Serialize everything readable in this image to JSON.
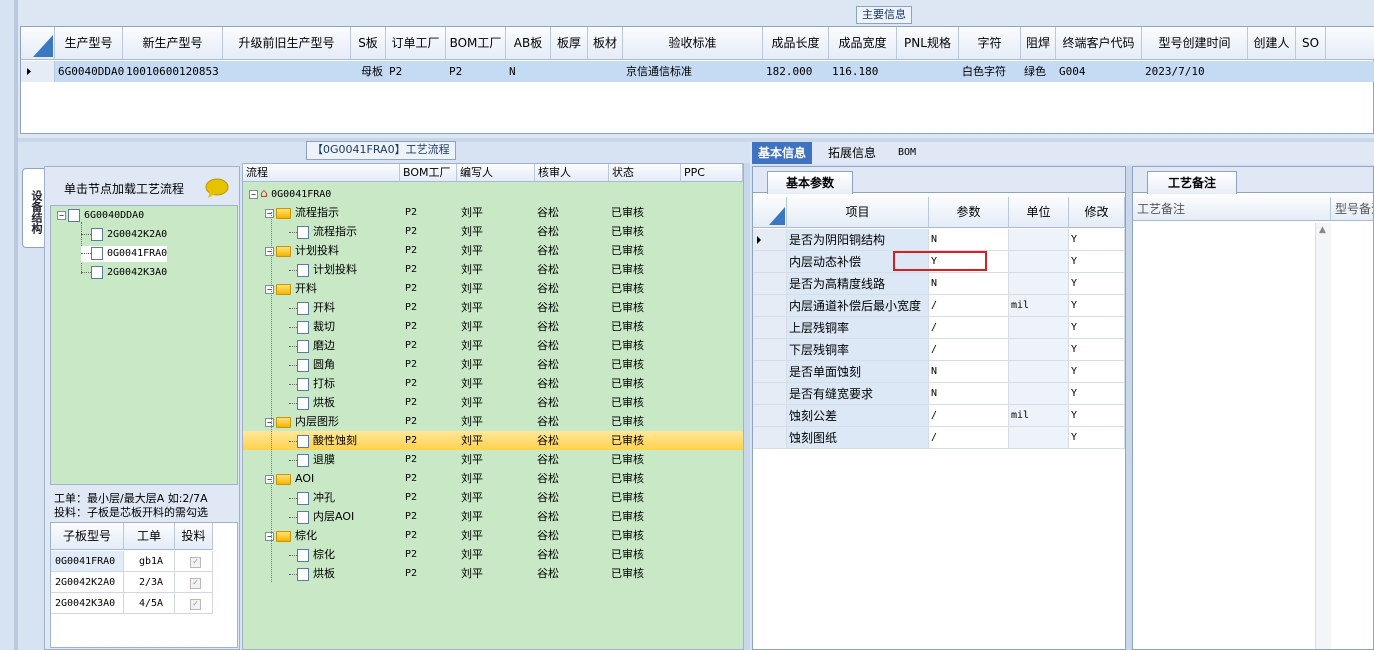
{
  "main_info": {
    "group_title": "主要信息",
    "columns": [
      "生产型号",
      "新生产型号",
      "升级前旧生产型号",
      "S板",
      "订单工厂",
      "BOM工厂",
      "AB板",
      "板厚",
      "板材",
      "验收标准",
      "成品长度",
      "成品宽度",
      "PNL规格",
      "字符",
      "阻焊",
      "终端客户代码",
      "型号创建时间",
      "创建人",
      "SO"
    ],
    "row": {
      "prod_model": "6G0040DDA0",
      "new_prod_model": "10010600120853",
      "old_model": "",
      "s_board": "母板",
      "order_factory": "P2",
      "bom_factory": "P2",
      "ab_board": "N",
      "thickness": "",
      "material": "",
      "acceptance": "京信通信标准",
      "length": "182.000",
      "width": "116.180",
      "pnl": "",
      "char": "白色字符",
      "solder": "绿色",
      "customer": "G004",
      "created": "2023/7/10",
      "creator": "",
      "so": ""
    }
  },
  "left": {
    "vertical_tab": "设备结构",
    "hint": "单击节点加载工艺流程",
    "tree": {
      "root": "6G0040DDA0",
      "children": [
        "2G0042K2A0",
        "0G0041FRA0",
        "2G0042K3A0"
      ]
    },
    "note_line1": "工单：最小层/最大层A 如:2/7A",
    "note_line2": "投料：子板是芯板开料的需勾选",
    "sub_columns": [
      "子板型号",
      "工单",
      "投料"
    ],
    "sub_rows": [
      {
        "model": "0G0041FRA0",
        "order": "gb1A",
        "feed": "✓"
      },
      {
        "model": "2G0042K2A0",
        "order": "2/3A",
        "feed": "✓"
      },
      {
        "model": "2G0042K3A0",
        "order": "4/5A",
        "feed": "✓"
      }
    ]
  },
  "flow": {
    "group_title": "【0G0041FRA0】工艺流程",
    "columns": [
      "流程",
      "BOM工厂",
      "编写人",
      "核审人",
      "状态",
      "PPC"
    ],
    "root": "0G0041FRA0",
    "rows": [
      {
        "name": "流程指示",
        "level": 1,
        "folder": true,
        "bom": "P2",
        "writer": "刘平",
        "reviewer": "谷松",
        "status": "已审核"
      },
      {
        "name": "流程指示",
        "level": 2,
        "folder": false,
        "bom": "P2",
        "writer": "刘平",
        "reviewer": "谷松",
        "status": "已审核"
      },
      {
        "name": "计划投料",
        "level": 1,
        "folder": true,
        "bom": "P2",
        "writer": "刘平",
        "reviewer": "谷松",
        "status": "已审核"
      },
      {
        "name": "计划投料",
        "level": 2,
        "folder": false,
        "bom": "P2",
        "writer": "刘平",
        "reviewer": "谷松",
        "status": "已审核"
      },
      {
        "name": "开料",
        "level": 1,
        "folder": true,
        "bom": "P2",
        "writer": "刘平",
        "reviewer": "谷松",
        "status": "已审核"
      },
      {
        "name": "开料",
        "level": 2,
        "folder": false,
        "bom": "P2",
        "writer": "刘平",
        "reviewer": "谷松",
        "status": "已审核"
      },
      {
        "name": "裁切",
        "level": 2,
        "folder": false,
        "bom": "P2",
        "writer": "刘平",
        "reviewer": "谷松",
        "status": "已审核"
      },
      {
        "name": "磨边",
        "level": 2,
        "folder": false,
        "bom": "P2",
        "writer": "刘平",
        "reviewer": "谷松",
        "status": "已审核"
      },
      {
        "name": "圆角",
        "level": 2,
        "folder": false,
        "bom": "P2",
        "writer": "刘平",
        "reviewer": "谷松",
        "status": "已审核"
      },
      {
        "name": "打标",
        "level": 2,
        "folder": false,
        "bom": "P2",
        "writer": "刘平",
        "reviewer": "谷松",
        "status": "已审核"
      },
      {
        "name": "烘板",
        "level": 2,
        "folder": false,
        "bom": "P2",
        "writer": "刘平",
        "reviewer": "谷松",
        "status": "已审核"
      },
      {
        "name": "内层图形",
        "level": 1,
        "folder": true,
        "bom": "P2",
        "writer": "刘平",
        "reviewer": "谷松",
        "status": "已审核"
      },
      {
        "name": "酸性蚀刻",
        "level": 2,
        "folder": false,
        "bom": "P2",
        "writer": "刘平",
        "reviewer": "谷松",
        "status": "已审核",
        "selected": true
      },
      {
        "name": "退膜",
        "level": 2,
        "folder": false,
        "bom": "P2",
        "writer": "刘平",
        "reviewer": "谷松",
        "status": "已审核"
      },
      {
        "name": "AOI",
        "level": 1,
        "folder": true,
        "bom": "P2",
        "writer": "刘平",
        "reviewer": "谷松",
        "status": "已审核"
      },
      {
        "name": "冲孔",
        "level": 2,
        "folder": false,
        "bom": "P2",
        "writer": "刘平",
        "reviewer": "谷松",
        "status": "已审核"
      },
      {
        "name": "内层AOI",
        "level": 2,
        "folder": false,
        "bom": "P2",
        "writer": "刘平",
        "reviewer": "谷松",
        "status": "已审核"
      },
      {
        "name": "棕化",
        "level": 1,
        "folder": true,
        "bom": "P2",
        "writer": "刘平",
        "reviewer": "谷松",
        "status": "已审核"
      },
      {
        "name": "棕化",
        "level": 2,
        "folder": false,
        "bom": "P2",
        "writer": "刘平",
        "reviewer": "谷松",
        "status": "已审核"
      },
      {
        "name": "烘板",
        "level": 2,
        "folder": false,
        "bom": "P2",
        "writer": "刘平",
        "reviewer": "谷松",
        "status": "已审核"
      }
    ]
  },
  "right": {
    "tabs": [
      "基本信息",
      "拓展信息",
      "BOM"
    ],
    "sub_tab": "基本参数",
    "columns": [
      "项目",
      "参数",
      "单位",
      "修改"
    ],
    "params": [
      {
        "item": "是否为阴阳铜结构",
        "value": "N",
        "unit": "",
        "edit": "Y"
      },
      {
        "item": "内层动态补偿",
        "value": "Y",
        "unit": "",
        "edit": "Y",
        "highlight": true
      },
      {
        "item": "是否为高精度线路",
        "value": "N",
        "unit": "",
        "edit": "Y"
      },
      {
        "item": "内层通道补偿后最小宽度",
        "value": "/",
        "unit": "mil",
        "edit": "Y"
      },
      {
        "item": "上层残铜率",
        "value": "/",
        "unit": "",
        "edit": "Y"
      },
      {
        "item": "下层残铜率",
        "value": "/",
        "unit": "",
        "edit": "Y"
      },
      {
        "item": "是否单面蚀刻",
        "value": "N",
        "unit": "",
        "edit": "Y"
      },
      {
        "item": "是否有缝宽要求",
        "value": "N",
        "unit": "",
        "edit": "Y"
      },
      {
        "item": "蚀刻公差",
        "value": "/",
        "unit": "mil",
        "edit": "Y"
      },
      {
        "item": "蚀刻图纸",
        "value": "/",
        "unit": "",
        "edit": "Y"
      }
    ],
    "remarks_tab": "工艺备注",
    "remarks_columns": [
      "工艺备注",
      "型号备注"
    ]
  },
  "colors": {
    "tree_bg": "#c8e8c6",
    "selected_row": "#ffd24d",
    "highlight_box": "#d62020",
    "header_sel": "#c5daf3"
  }
}
